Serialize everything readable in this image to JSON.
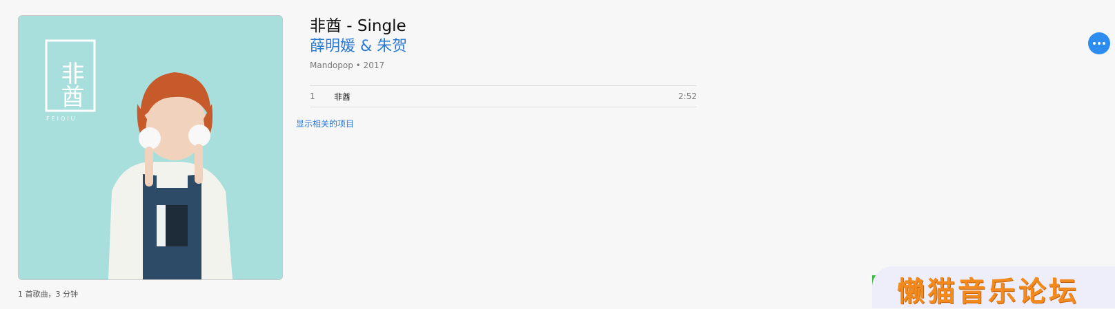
{
  "album": {
    "title": "非酋 - Single",
    "artist": "薛明媛 & 朱贺",
    "meta": "Mandopop • 2017",
    "footer": "1 首歌曲，3 分钟",
    "cover_title": "非酋",
    "cover_subtitle": "FEIQIU"
  },
  "tracks": [
    {
      "number": "1",
      "name": "非酋",
      "duration": "2:52"
    }
  ],
  "related_link": "显示相关的项目",
  "watermark": "懒猫音乐论坛",
  "colors": {
    "background": "#f7f7f8",
    "link": "#2b7bd4",
    "accent_button": "#2d8cf0",
    "cover_bg": "#a8dfdd",
    "watermark_text": "#f28a1e"
  },
  "icons": {
    "more": "ellipsis-icon"
  }
}
